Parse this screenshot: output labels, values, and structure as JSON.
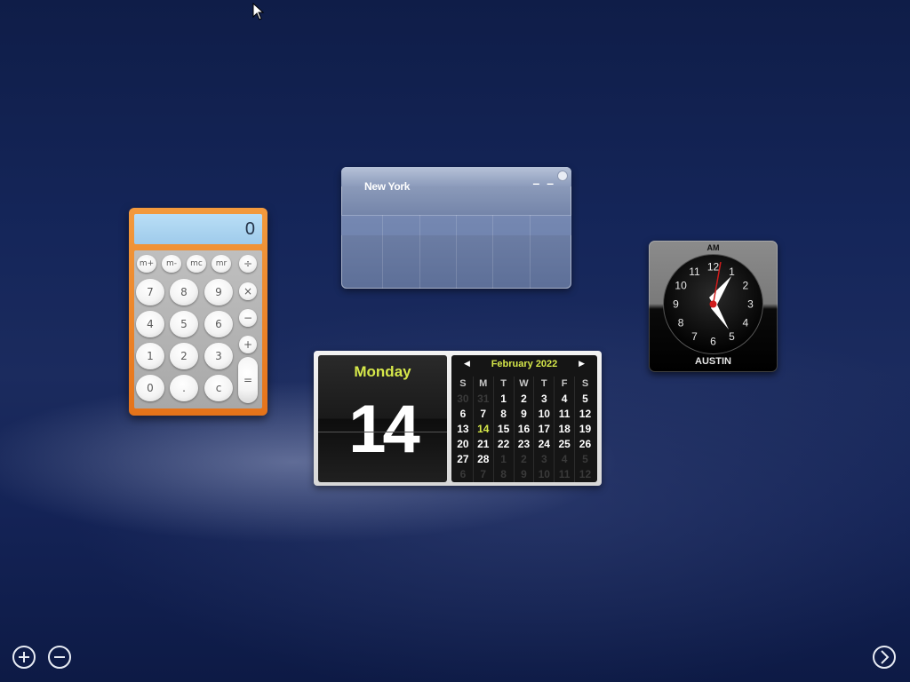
{
  "calculator": {
    "display": "0",
    "memory_keys": [
      "m+",
      "m-",
      "mc",
      "mr"
    ],
    "operator_keys": [
      "÷",
      "×",
      "−",
      "+",
      "="
    ],
    "number_rows": [
      [
        "7",
        "8",
        "9"
      ],
      [
        "4",
        "5",
        "6"
      ],
      [
        "1",
        "2",
        "3"
      ],
      [
        "0",
        ".",
        "c"
      ]
    ]
  },
  "weather": {
    "city": "New York",
    "temperature": "– –"
  },
  "calendar": {
    "day_name": "Monday",
    "day_number": "14",
    "month_label": "February 2022",
    "weekday_headers": [
      "S",
      "M",
      "T",
      "W",
      "T",
      "F",
      "S"
    ],
    "weeks": [
      [
        "30",
        "31",
        "1",
        "2",
        "3",
        "4",
        "5"
      ],
      [
        "6",
        "7",
        "8",
        "9",
        "10",
        "11",
        "12"
      ],
      [
        "13",
        "14",
        "15",
        "16",
        "17",
        "18",
        "19"
      ],
      [
        "20",
        "21",
        "22",
        "23",
        "24",
        "25",
        "26"
      ],
      [
        "27",
        "28",
        "1",
        "2",
        "3",
        "4",
        "5"
      ],
      [
        "6",
        "7",
        "8",
        "9",
        "10",
        "11",
        "12"
      ]
    ],
    "today": "14"
  },
  "clock": {
    "ampm": "AM",
    "city": "AUSTIN",
    "numerals": [
      "12",
      "1",
      "2",
      "3",
      "4",
      "5",
      "6",
      "7",
      "8",
      "9",
      "10",
      "11"
    ],
    "hour_hand_color": "#ffffff",
    "second_hand_color": "#d01c1c"
  },
  "dock": {
    "add_icon": "plus-circle-icon",
    "remove_icon": "minus-circle-icon",
    "next_icon": "arrow-right-circle-icon"
  }
}
